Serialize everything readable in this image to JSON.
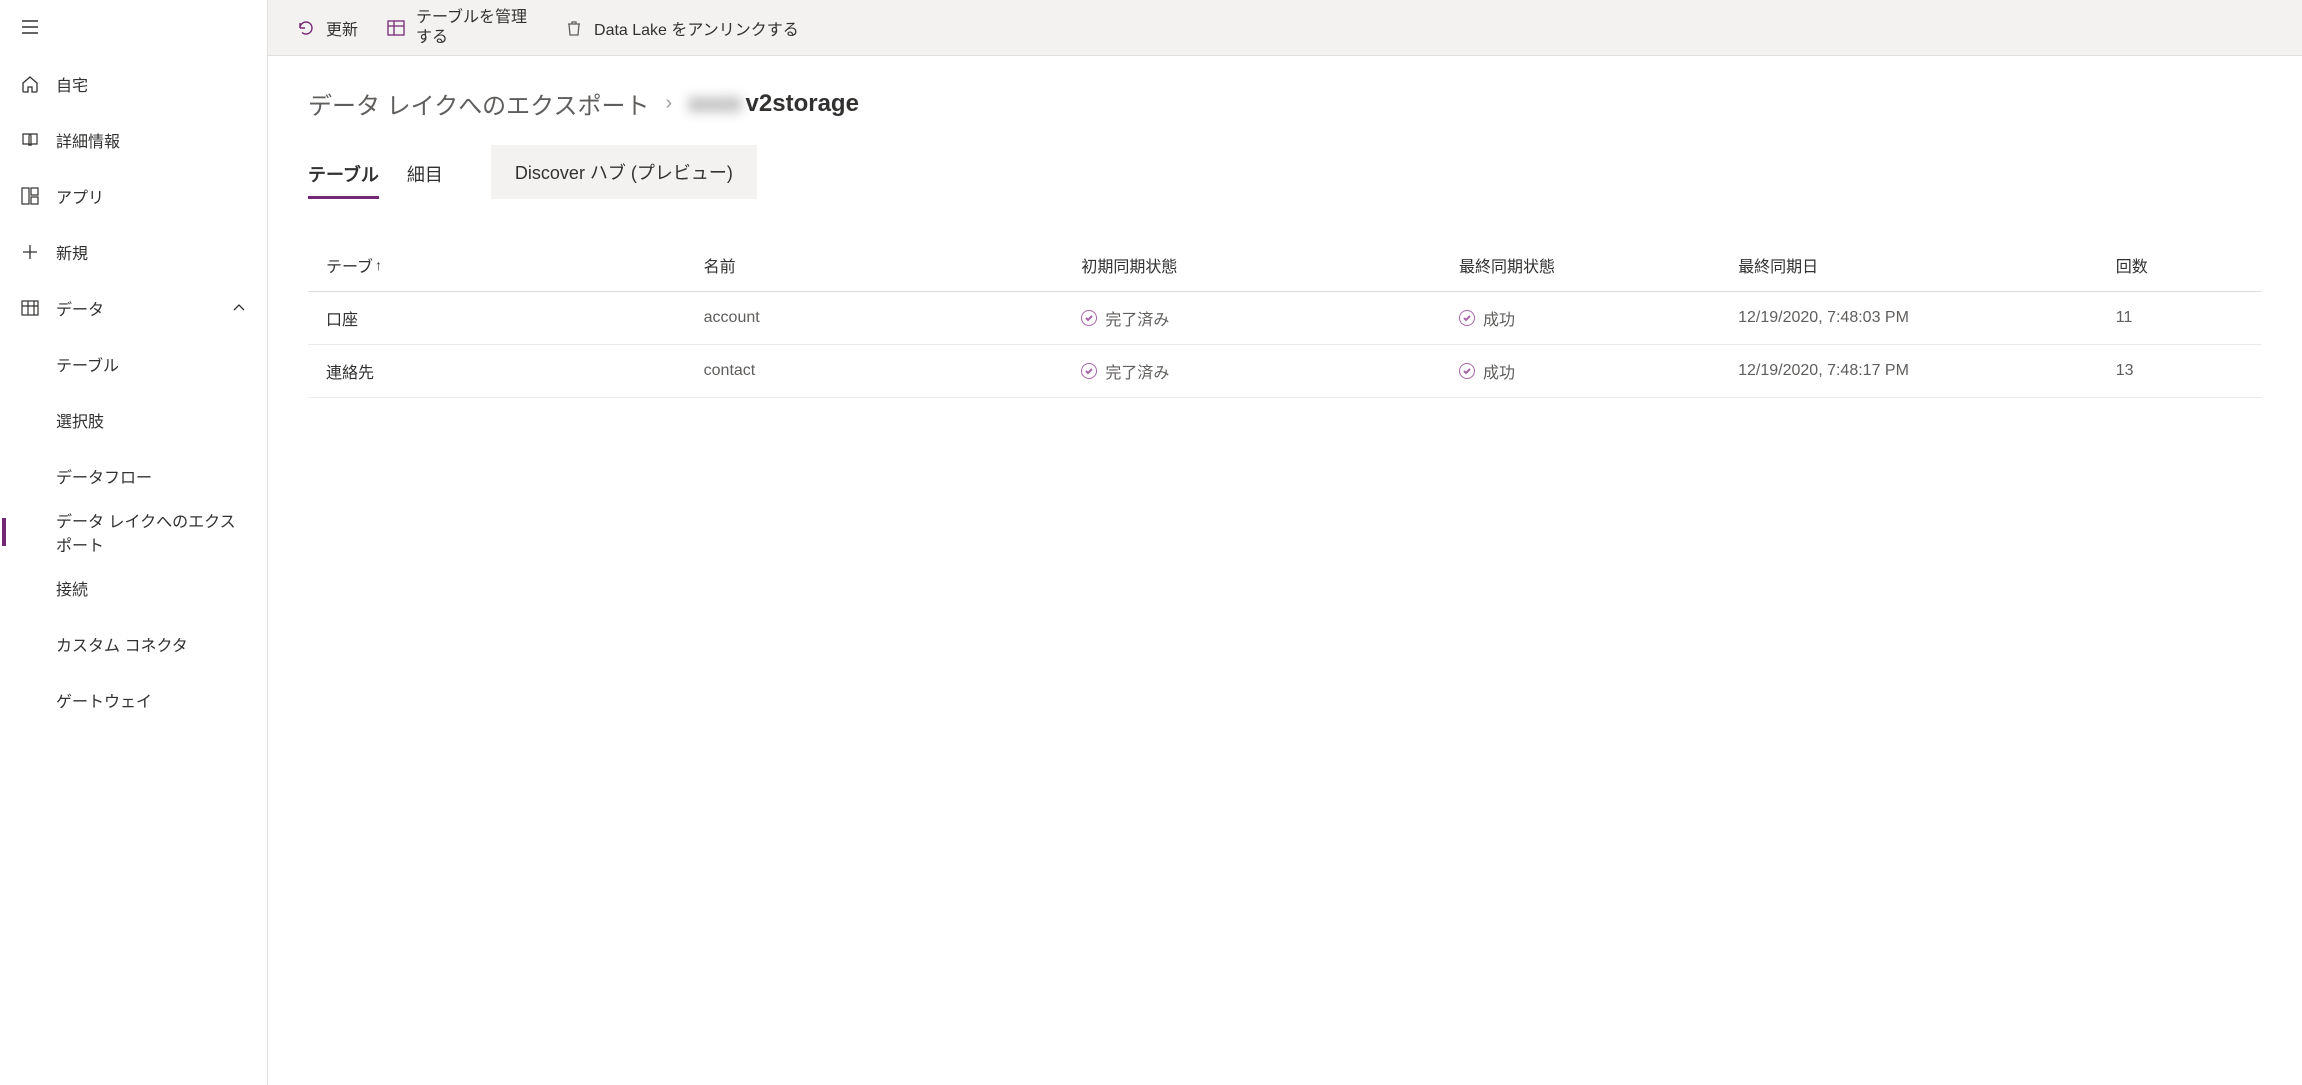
{
  "sidebar": {
    "items": [
      {
        "label": "自宅",
        "icon": "home"
      },
      {
        "label": "詳細情報",
        "icon": "book"
      },
      {
        "label": "アプリ",
        "icon": "apps"
      },
      {
        "label": "新規",
        "icon": "plus"
      },
      {
        "label": "データ",
        "icon": "table",
        "expanded": true
      }
    ],
    "sub_items": [
      {
        "label": "テーブル"
      },
      {
        "label": "選択肢"
      },
      {
        "label": "データフロー"
      },
      {
        "label": "データ レイクへのエクスポート",
        "active": true
      },
      {
        "label": "接続"
      },
      {
        "label": "カスタム コネクタ"
      },
      {
        "label": "ゲートウェイ"
      }
    ]
  },
  "toolbar": {
    "refresh": "更新",
    "manage_tables": "テーブルを管理する",
    "unlink": "Data Lake をアンリンクする"
  },
  "breadcrumb": {
    "parent": "データ レイクへのエクスポート",
    "current_prefix": "xxxx",
    "current": "v2storage"
  },
  "tabs": {
    "tables": "テーブル",
    "details": "細目",
    "discover": "Discover ハブ (プレビュー)"
  },
  "table": {
    "headers": {
      "table": "テーブ",
      "name": "名前",
      "initial_sync": "初期同期状態",
      "last_sync_state": "最終同期状態",
      "last_sync_date": "最終同期日",
      "count": "回数"
    },
    "rows": [
      {
        "table": "口座",
        "name": "account",
        "initial_sync": "完了済み",
        "last_sync_state": "成功",
        "last_sync_date": "12/19/2020, 7:48:03 PM",
        "count": "11"
      },
      {
        "table": "連絡先",
        "name": "contact",
        "initial_sync": "完了済み",
        "last_sync_state": "成功",
        "last_sync_date": "12/19/2020, 7:48:17 PM",
        "count": "13"
      }
    ]
  }
}
